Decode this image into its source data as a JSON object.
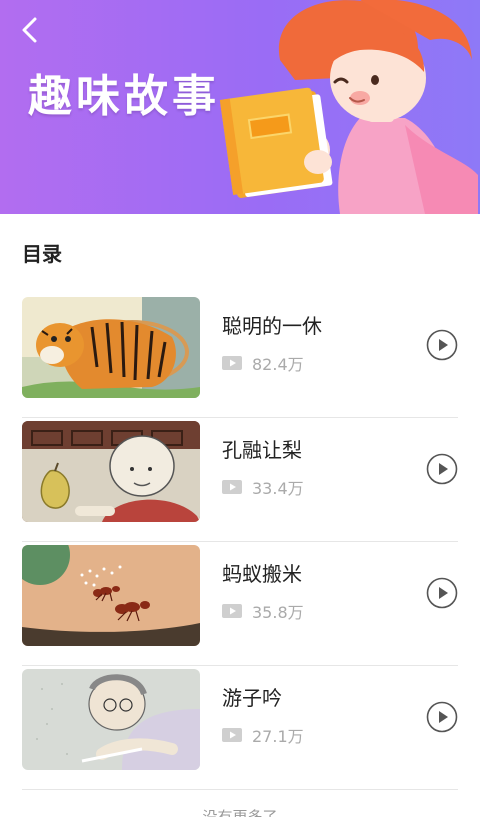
{
  "header": {
    "title": "趣味故事",
    "back_icon": "chevron-left-icon",
    "gradient": [
      "#b26df0",
      "#8e79f7"
    ]
  },
  "catalog": {
    "title": "目录",
    "items": [
      {
        "title": "聪明的一休",
        "plays": "82.4万",
        "thumbnail": "tiger"
      },
      {
        "title": "孔融让梨",
        "plays": "33.4万",
        "thumbnail": "child-with-pear"
      },
      {
        "title": "蚂蚁搬米",
        "plays": "35.8万",
        "thumbnail": "ants"
      },
      {
        "title": "游子吟",
        "plays": "27.1万",
        "thumbnail": "mother-sewing"
      }
    ]
  },
  "footer": {
    "text": "没有更多了"
  },
  "colors": {
    "accent": "#a86ef2",
    "text": "#222222",
    "muted": "#aaaaaa",
    "divider": "#e6e6e6"
  }
}
